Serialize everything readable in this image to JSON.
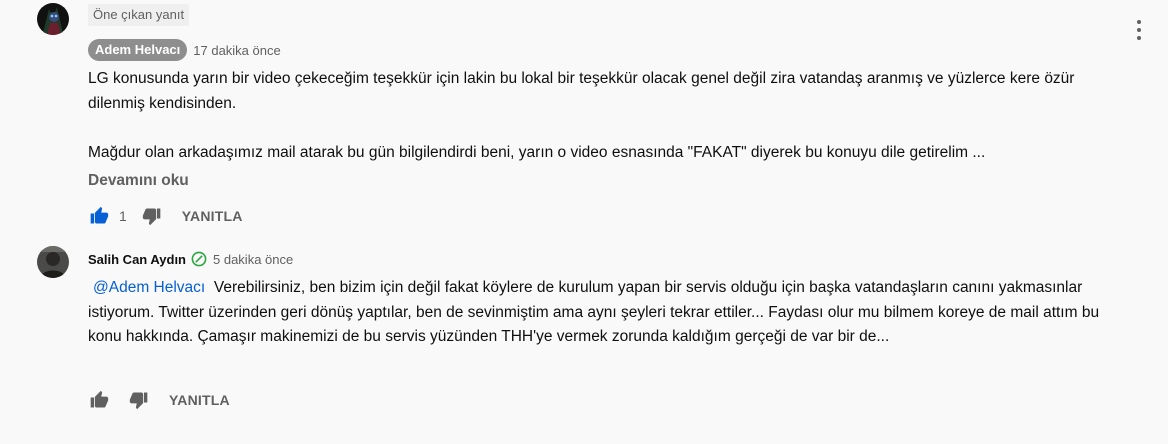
{
  "comment": {
    "pinned_label": "Öne çıkan yanıt",
    "author": "Adem Helvacı",
    "time": "17 dakika önce",
    "text_paragraph1": "LG konusunda yarın bir video çekeceğim teşekkür için lakin bu lokal bir teşekkür olacak genel değil zira vatandaş aranmış ve yüzlerce kere özür dilenmiş kendisinden.",
    "text_paragraph2": "Mağdur olan arkadaşımız mail atarak bu gün bilgilendirdi beni, yarın o video esnasında \"FAKAT\" diyerek bu konuyu dile getirelim ...",
    "read_more": "Devamını oku",
    "like_count": "1",
    "reply_label": "YANITLA"
  },
  "reply": {
    "author": "Salih Can Aydın",
    "time": "5 dakika önce",
    "mention": "@Adem Helvacı",
    "text": "Verebilirsiniz, ben bizim için değil fakat köylere de kurulum yapan bir servis olduğu için başka vatandaşların canını yakmasınlar istiyorum. Twitter üzerinden geri dönüş yaptılar, ben de sevinmiştim ama aynı şeyleri tekrar ettiler... Faydası olur mu bilmem koreye de mail attım bu konu hakkında. Çamaşır makinemizi de bu servis yüzünden THH'ye vermek zorunda kaldığım gerçeği de var bir de...",
    "reply_label": "YANITLA"
  },
  "icons": {
    "like": "thumbs-up-icon",
    "dislike": "thumbs-down-icon",
    "menu": "more-vert-icon",
    "verified": "verified-check-icon"
  },
  "colors": {
    "background": "#f9f9f9",
    "link": "#065fd4",
    "like_active": "#065fd4",
    "secondary_text": "#606060",
    "author_chip": "#8e8e8e",
    "verified": "#2ba640"
  }
}
